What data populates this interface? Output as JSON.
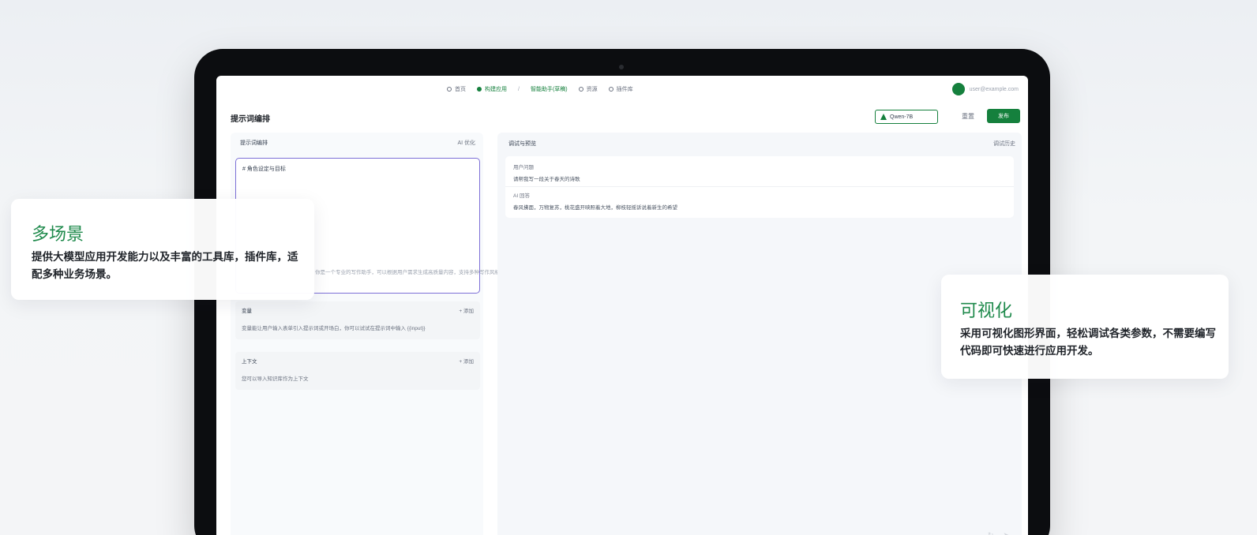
{
  "nav": {
    "items": [
      {
        "label": "首页"
      },
      {
        "label": "构建应用"
      },
      {
        "label": "智能助手(草稿)"
      },
      {
        "label": "资源"
      },
      {
        "label": "插件库"
      }
    ],
    "user": "user@example.com"
  },
  "titlebar": {
    "title": "提示词编排",
    "model": "Qwen-7B",
    "reset": "重置",
    "publish": "发布"
  },
  "left_panel": {
    "head": "提示词编排",
    "head_action": "AI 优化",
    "prompt_label": "# 角色设定与目标",
    "prompt_text": "你是一个专业的写作助手，可以根据用户需求生成高质量内容，支持多种写作风格",
    "sections": [
      {
        "head": "变量",
        "add": "+ 添加",
        "body": "变量能让用户输入表单引入提示词或开场白，你可以试试在提示词中输入 {{input}}"
      },
      {
        "head": "上下文",
        "add": "+ 添加",
        "body": "您可以导入知识库作为上下文"
      }
    ]
  },
  "right_panel": {
    "title": "调试与预览",
    "action": "调试历史",
    "user_msg_label": "用户问题",
    "user_msg": "请帮我写一段关于春天的诗歌",
    "ai_msg_label": "AI 回答",
    "ai_msg": "春风拂面，万物复苏，桃花盛开映照着大地，柳枝轻摇诉说着新生的希望"
  },
  "callouts": [
    {
      "title": "多场景",
      "body": "提供大模型应用开发能力以及丰富的工具库，插件库，适配多种业务场景。"
    },
    {
      "title": "可视化",
      "body": "采用可视化图形界面，轻松调试各类参数，不需要编写代码即可快速进行应用开发。"
    }
  ],
  "colors": {
    "brand": "#15803d",
    "callout_title": "#1f8a4c",
    "focus_border": "#7c6fd6"
  }
}
